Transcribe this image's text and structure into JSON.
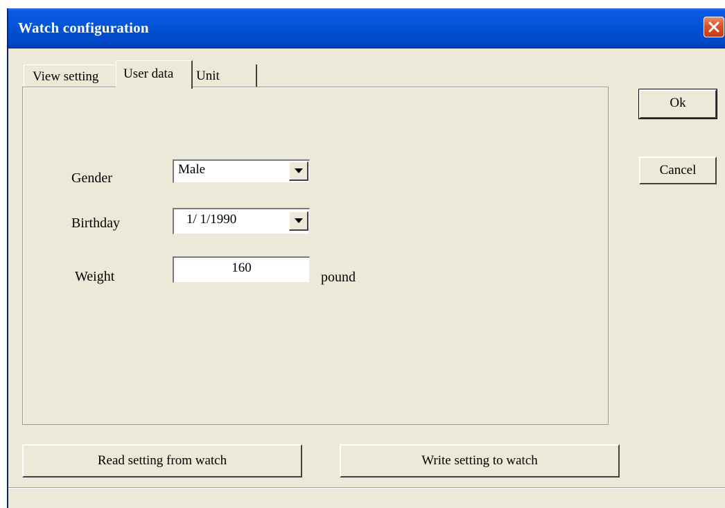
{
  "window": {
    "title": "Watch configuration"
  },
  "tabs": [
    {
      "label": "View setting",
      "active": false
    },
    {
      "label": "User data",
      "active": true
    },
    {
      "label": "Unit",
      "active": false
    }
  ],
  "form": {
    "gender": {
      "label": "Gender",
      "value": "Male"
    },
    "birthday": {
      "label": "Birthday",
      "value": "1/ 1/1990"
    },
    "weight": {
      "label": "Weight",
      "value": "160",
      "unit": "pound"
    }
  },
  "buttons": {
    "ok": "Ok",
    "cancel": "Cancel",
    "read": "Read setting from watch",
    "write": "Write setting to watch"
  },
  "icons": {
    "close": "close-icon",
    "dropdown": "chevron-down-icon"
  },
  "colors": {
    "titlebar": "#0455d8",
    "close_button": "#d9532b",
    "dialog_background": "#ece9d8"
  }
}
